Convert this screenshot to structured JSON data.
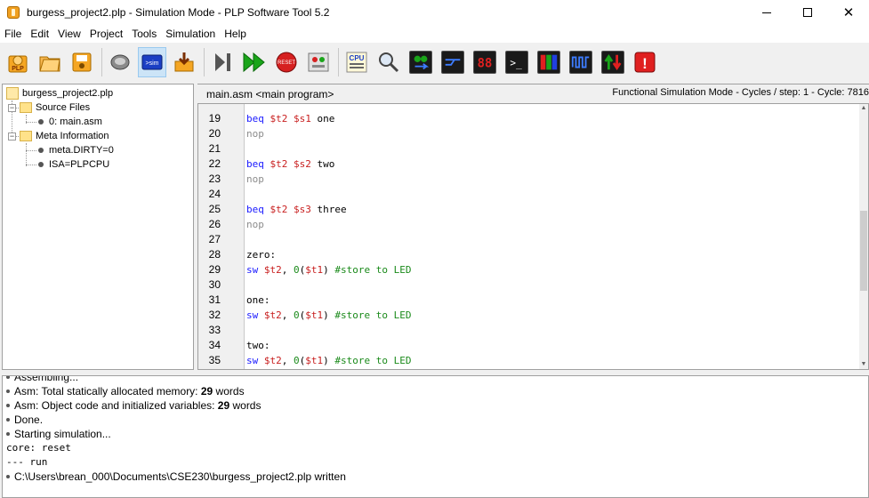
{
  "window": {
    "title": "burgess_project2.plp - Simulation Mode  - PLP Software Tool 5.2",
    "minimize_label": "",
    "close_label": "✕"
  },
  "menu": [
    "File",
    "Edit",
    "View",
    "Project",
    "Tools",
    "Simulation",
    "Help"
  ],
  "toolbar": {
    "reset_label": "RESET",
    "cpu_label": "CPU",
    "seven_seg_label": "88",
    "terminal_label": ">_",
    "alert_label": "!"
  },
  "tree": {
    "root": "burgess_project2.plp",
    "source_folder": "Source Files",
    "source_file": "0: main.asm",
    "meta_folder": "Meta Information",
    "meta_items": [
      "meta.DIRTY=0",
      "ISA=PLPCPU"
    ]
  },
  "editor": {
    "tab": "main.asm <main program>",
    "status": "Functional Simulation Mode - Cycles / step: 1 - Cycle: 7816",
    "lines": [
      {
        "n": "19",
        "tokens": [
          {
            "t": "beq ",
            "c": "kw"
          },
          {
            "t": "$t2 ",
            "c": "reg"
          },
          {
            "t": "$s1 ",
            "c": "reg"
          },
          {
            "t": "one",
            "c": "lbl"
          }
        ]
      },
      {
        "n": "20",
        "tokens": [
          {
            "t": "nop",
            "c": "nop"
          }
        ]
      },
      {
        "n": "21",
        "tokens": []
      },
      {
        "n": "22",
        "tokens": [
          {
            "t": "beq ",
            "c": "kw"
          },
          {
            "t": "$t2 ",
            "c": "reg"
          },
          {
            "t": "$s2 ",
            "c": "reg"
          },
          {
            "t": "two",
            "c": "lbl"
          }
        ]
      },
      {
        "n": "23",
        "tokens": [
          {
            "t": "nop",
            "c": "nop"
          }
        ]
      },
      {
        "n": "24",
        "tokens": []
      },
      {
        "n": "25",
        "tokens": [
          {
            "t": "beq ",
            "c": "kw"
          },
          {
            "t": "$t2 ",
            "c": "reg"
          },
          {
            "t": "$s3 ",
            "c": "reg"
          },
          {
            "t": "three",
            "c": "lbl"
          }
        ]
      },
      {
        "n": "26",
        "tokens": [
          {
            "t": "nop",
            "c": "nop"
          }
        ]
      },
      {
        "n": "27",
        "tokens": []
      },
      {
        "n": "28",
        "tokens": [
          {
            "t": "zero:",
            "c": "lbl"
          }
        ]
      },
      {
        "n": "29",
        "tokens": [
          {
            "t": "sw ",
            "c": "sw"
          },
          {
            "t": "$t2",
            "c": "reg"
          },
          {
            "t": ", ",
            "c": "lbl"
          },
          {
            "t": "0",
            "c": "num"
          },
          {
            "t": "(",
            "c": "lbl"
          },
          {
            "t": "$t1",
            "c": "reg"
          },
          {
            "t": ") ",
            "c": "lbl"
          },
          {
            "t": "#store to LED",
            "c": "cmt"
          }
        ]
      },
      {
        "n": "30",
        "tokens": []
      },
      {
        "n": "31",
        "tokens": [
          {
            "t": "one:",
            "c": "lbl"
          }
        ]
      },
      {
        "n": "32",
        "tokens": [
          {
            "t": "sw ",
            "c": "sw"
          },
          {
            "t": "$t2",
            "c": "reg"
          },
          {
            "t": ", ",
            "c": "lbl"
          },
          {
            "t": "0",
            "c": "num"
          },
          {
            "t": "(",
            "c": "lbl"
          },
          {
            "t": "$t1",
            "c": "reg"
          },
          {
            "t": ") ",
            "c": "lbl"
          },
          {
            "t": "#store to LED",
            "c": "cmt"
          }
        ]
      },
      {
        "n": "33",
        "tokens": []
      },
      {
        "n": "34",
        "tokens": [
          {
            "t": "two:",
            "c": "lbl"
          }
        ]
      },
      {
        "n": "35",
        "tokens": [
          {
            "t": "sw ",
            "c": "sw"
          },
          {
            "t": "$t2",
            "c": "reg"
          },
          {
            "t": ", ",
            "c": "lbl"
          },
          {
            "t": "0",
            "c": "num"
          },
          {
            "t": "(",
            "c": "lbl"
          },
          {
            "t": "$t1",
            "c": "reg"
          },
          {
            "t": ") ",
            "c": "lbl"
          },
          {
            "t": "#store to LED",
            "c": "cmt"
          }
        ]
      }
    ]
  },
  "console": {
    "lines": [
      {
        "bullet": true,
        "mono": false,
        "text": "Assembling...",
        "bold": ""
      },
      {
        "bullet": true,
        "mono": false,
        "text": "Asm: Total statically allocated memory: ",
        "bold": "29",
        "suffix": " words"
      },
      {
        "bullet": true,
        "mono": false,
        "text": "Asm: Object code and initialized variables: ",
        "bold": "29",
        "suffix": " words"
      },
      {
        "bullet": true,
        "mono": false,
        "text": "Done.",
        "bold": ""
      },
      {
        "bullet": true,
        "mono": false,
        "text": "Starting simulation...",
        "bold": ""
      },
      {
        "bullet": false,
        "mono": true,
        "text": "core: reset",
        "bold": ""
      },
      {
        "bullet": false,
        "mono": true,
        "text": "--- run",
        "bold": ""
      },
      {
        "bullet": true,
        "mono": false,
        "text": "C:\\Users\\brean_000\\Documents\\CSE230\\burgess_project2.plp written",
        "bold": ""
      }
    ]
  },
  "colors": {
    "keyword": "#1a1aff",
    "register": "#c81e1e",
    "comment": "#1a8a1a",
    "nop": "#8c8c8c"
  }
}
